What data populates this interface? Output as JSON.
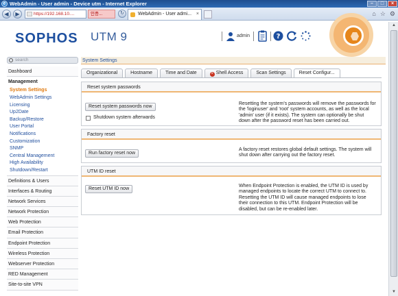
{
  "window": {
    "title": "WebAdmin - User admin - Device utm - Internet Explorer"
  },
  "browser": {
    "url": "https://192.168.10....",
    "cert_error_label": "인증...",
    "tab_title": "WebAdmin - User admi...",
    "tab_close": "×"
  },
  "header": {
    "brand": "SOPHOS",
    "product": "UTM 9",
    "user": "admin"
  },
  "search": {
    "placeholder": "search"
  },
  "nav": {
    "dashboard": "Dashboard",
    "management": "Management",
    "management_items": [
      "System Settings",
      "WebAdmin Settings",
      "Licensing",
      "Up2Date",
      "Backup/Restore",
      "User Portal",
      "Notifications",
      "Customization",
      "SNMP",
      "Central Management",
      "High Availability",
      "Shutdown/Restart"
    ],
    "items": [
      "Definitions & Users",
      "Interfaces & Routing",
      "Network Services",
      "Network Protection",
      "Web Protection",
      "Email Protection",
      "Endpoint Protection",
      "Wireless Protection",
      "Webserver Protection",
      "RED Management",
      "Site-to-site VPN"
    ]
  },
  "breadcrumb": "System Settings",
  "tabs": [
    "Organizational",
    "Hostname",
    "Time and Date",
    "Shell Access",
    "Scan Settings",
    "Reset Configur..."
  ],
  "panels": {
    "reset_passwords": {
      "title": "Reset system passwords",
      "button": "Reset system passwords now",
      "checkbox_label": "Shutdown system afterwards",
      "description": "Resetting the system's passwords will remove the passwords for the 'loginuser' and 'root' system accounts, as well as the local 'admin' user (if it exists). The system can optionally be shut down after the password reset has been carried out."
    },
    "factory_reset": {
      "title": "Factory reset",
      "button": "Run factory reset now",
      "description": "A factory reset restores global default settings. The system will shut down after carrying out the factory reset."
    },
    "utm_id_reset": {
      "title": "UTM ID reset",
      "button": "Reset UTM ID now",
      "description": "When Endpoint Protection is enabled, the UTM ID is used by managed endpoints to locate the correct UTM to connect to. Resetting the UTM ID will cause managed endpoints to lose their connection to this UTM. Endpoint Protection will be disabled, but can be re-enabled later."
    }
  },
  "colors": {
    "brand_blue": "#1d4f9f",
    "accent_orange": "#e6861c",
    "error_red": "#c8331f"
  }
}
